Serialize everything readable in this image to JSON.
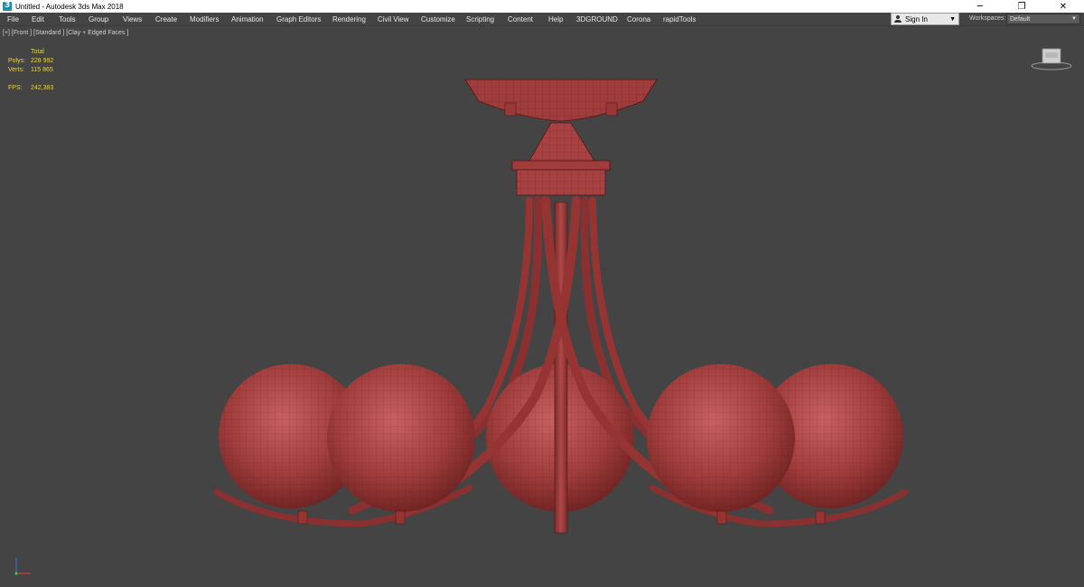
{
  "window": {
    "title": "Untitled - Autodesk 3ds Max 2018",
    "controls": [
      "─",
      "❐",
      "✕"
    ]
  },
  "menu": {
    "items": [
      "File",
      "Edit",
      "Tools",
      "Group",
      "Views",
      "Create",
      "Modifiers",
      "Animation",
      "Graph Editors",
      "Rendering",
      "Civil View",
      "Customize",
      "Scripting",
      "Content",
      "Help",
      "3DGROUND",
      "Corona",
      "rapidTools"
    ],
    "sign_in": "Sign In",
    "workspaces_label": "Workspaces:",
    "workspace_value": "Default"
  },
  "viewport": {
    "label": "[+] [Front ] [Standard ] [Clay + Edged Faces ]",
    "stats": {
      "header": "Total",
      "polys_label": "Polys:",
      "polys_value": "228 992",
      "verts_label": "Verts:",
      "verts_value": "115 865",
      "fps_label": "FPS:",
      "fps_value": "242,383"
    },
    "model_color": "#a84040",
    "wire_color": "#5a1414",
    "background": "#444444"
  },
  "colors": {
    "stats_text": "#e0d060",
    "menu_bg": "#444444",
    "titlebar_bg": "#ffffff"
  }
}
